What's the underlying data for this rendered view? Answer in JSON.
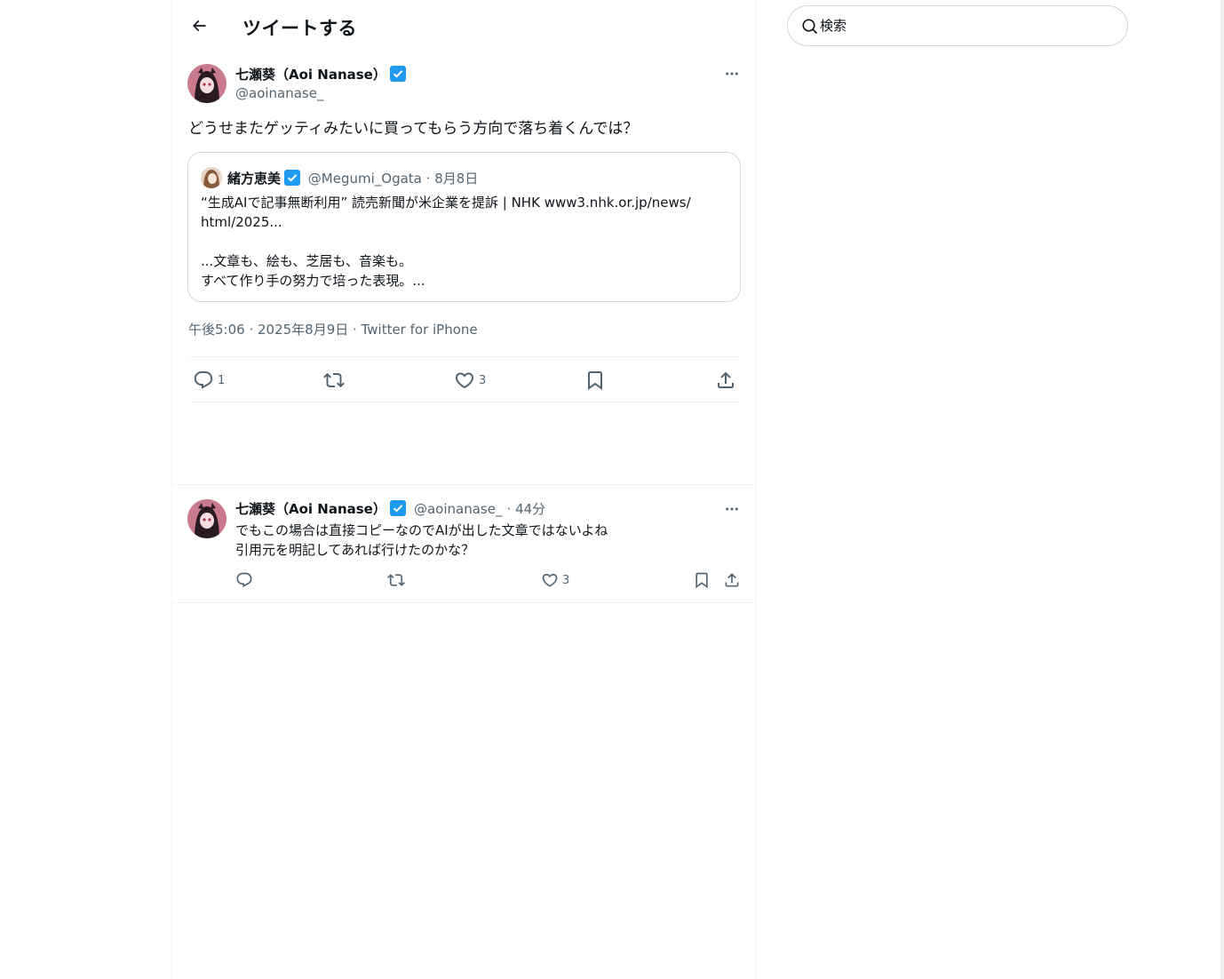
{
  "header": {
    "title": "ツイートする"
  },
  "tweet": {
    "author": {
      "name": "七瀬葵（Aoi Nanase）",
      "handle": "@aoinanase_"
    },
    "text": "どうせまたゲッティみたいに買ってもらう方向で落ち着くんでは？",
    "quote": {
      "author_name": "緒方恵美",
      "handle": "@Megumi_Ogata",
      "date": "· 8月8日",
      "lines": [
        "“生成AIで記事無断利用”  読売新聞が米企業を提訴 | NHK   www3.nhk.or.jp/news/",
        "html/2025...",
        "",
        "...文章も、絵も、芝居も、音楽も。",
        "すべて作り手の努力で培った表現。..."
      ]
    },
    "time": "午後5:06",
    "date": "2025年8月9日",
    "source": "Twitter for iPhone",
    "sep": " · ",
    "stats": {
      "replies": "1",
      "retweets": "",
      "likes": "3"
    }
  },
  "reply": {
    "author": {
      "name": "七瀬葵（Aoi Nanase）",
      "handle": "@aoinanase_",
      "time": "· 44分"
    },
    "lines": [
      "でもこの場合は直接コピーなのでAIが出した文章ではないよね",
      "引用元を明記してあれば行けたのかな？"
    ],
    "stats": {
      "replies": "",
      "retweets": "",
      "likes": "3"
    }
  },
  "search": {
    "placeholder": "検索",
    "value": ""
  },
  "colors": {
    "text": "#0f1419",
    "secondary": "#536471",
    "verified": "#1d9bf0",
    "border": "#cfd9de"
  }
}
